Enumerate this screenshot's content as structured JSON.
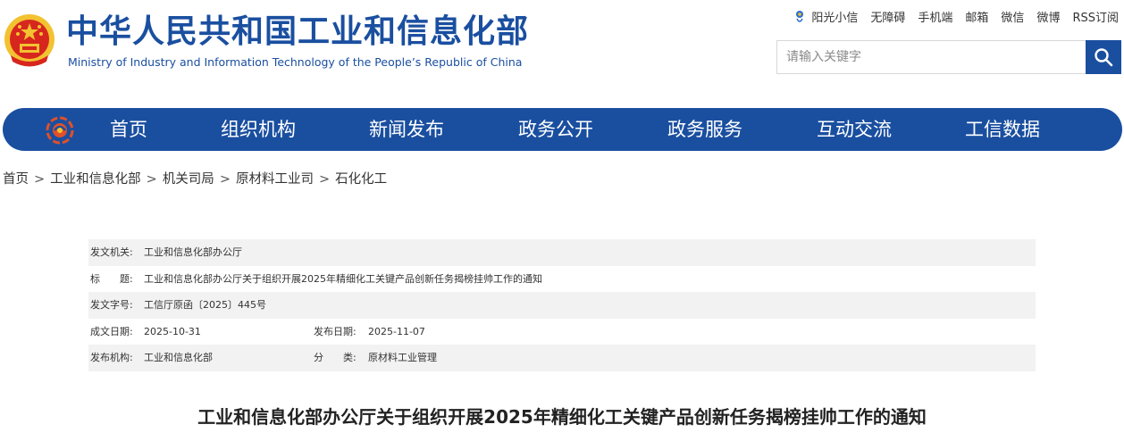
{
  "header": {
    "title_cn": "中华人民共和国工业和信息化部",
    "title_en": "Ministry of Industry and Information Technology of the People’s Republic of China",
    "links": [
      "阳光小信",
      "无障碍",
      "手机端",
      "邮箱",
      "微信",
      "微博",
      "RSS订阅"
    ],
    "search": {
      "placeholder": "请输入关键字"
    }
  },
  "nav": {
    "items": [
      "首页",
      "组织机构",
      "新闻发布",
      "政务公开",
      "政务服务",
      "互动交流",
      "工信数据"
    ]
  },
  "breadcrumb": {
    "items": [
      "首页",
      "工业和信息化部",
      "机关司局",
      "原材料工业司",
      "石化化工"
    ],
    "separator": ">"
  },
  "meta": {
    "issuer_label": "发文机关:",
    "issuer": "工业和信息化部办公厅",
    "title_label": "标　　题:",
    "title": "工业和信息化部办公厅关于组织开展2025年精细化工关键产品创新任务揭榜挂帅工作的通知",
    "doc_no_label": "发文字号:",
    "doc_no": "工信厅原函〔2025〕445号",
    "created_label": "成文日期:",
    "created": "2025-10-31",
    "published_label": "发布日期:",
    "published": "2025-11-07",
    "org_label": "发布机构:",
    "org": "工业和信息化部",
    "category_label": "分　　类:",
    "category": "原材料工业管理"
  },
  "document": {
    "title": "工业和信息化部办公厅关于组织开展2025年精细化工关键产品创新任务揭榜挂帅工作的通知"
  },
  "colors": {
    "brand_blue": "#1a4fa0",
    "emblem_red": "#d7261e",
    "emblem_gold": "#f2c230",
    "meta_bg": "#f2f2f2"
  },
  "icons": [
    "national-emblem-icon",
    "sun-icon",
    "search-icon",
    "nav-logo-icon"
  ]
}
